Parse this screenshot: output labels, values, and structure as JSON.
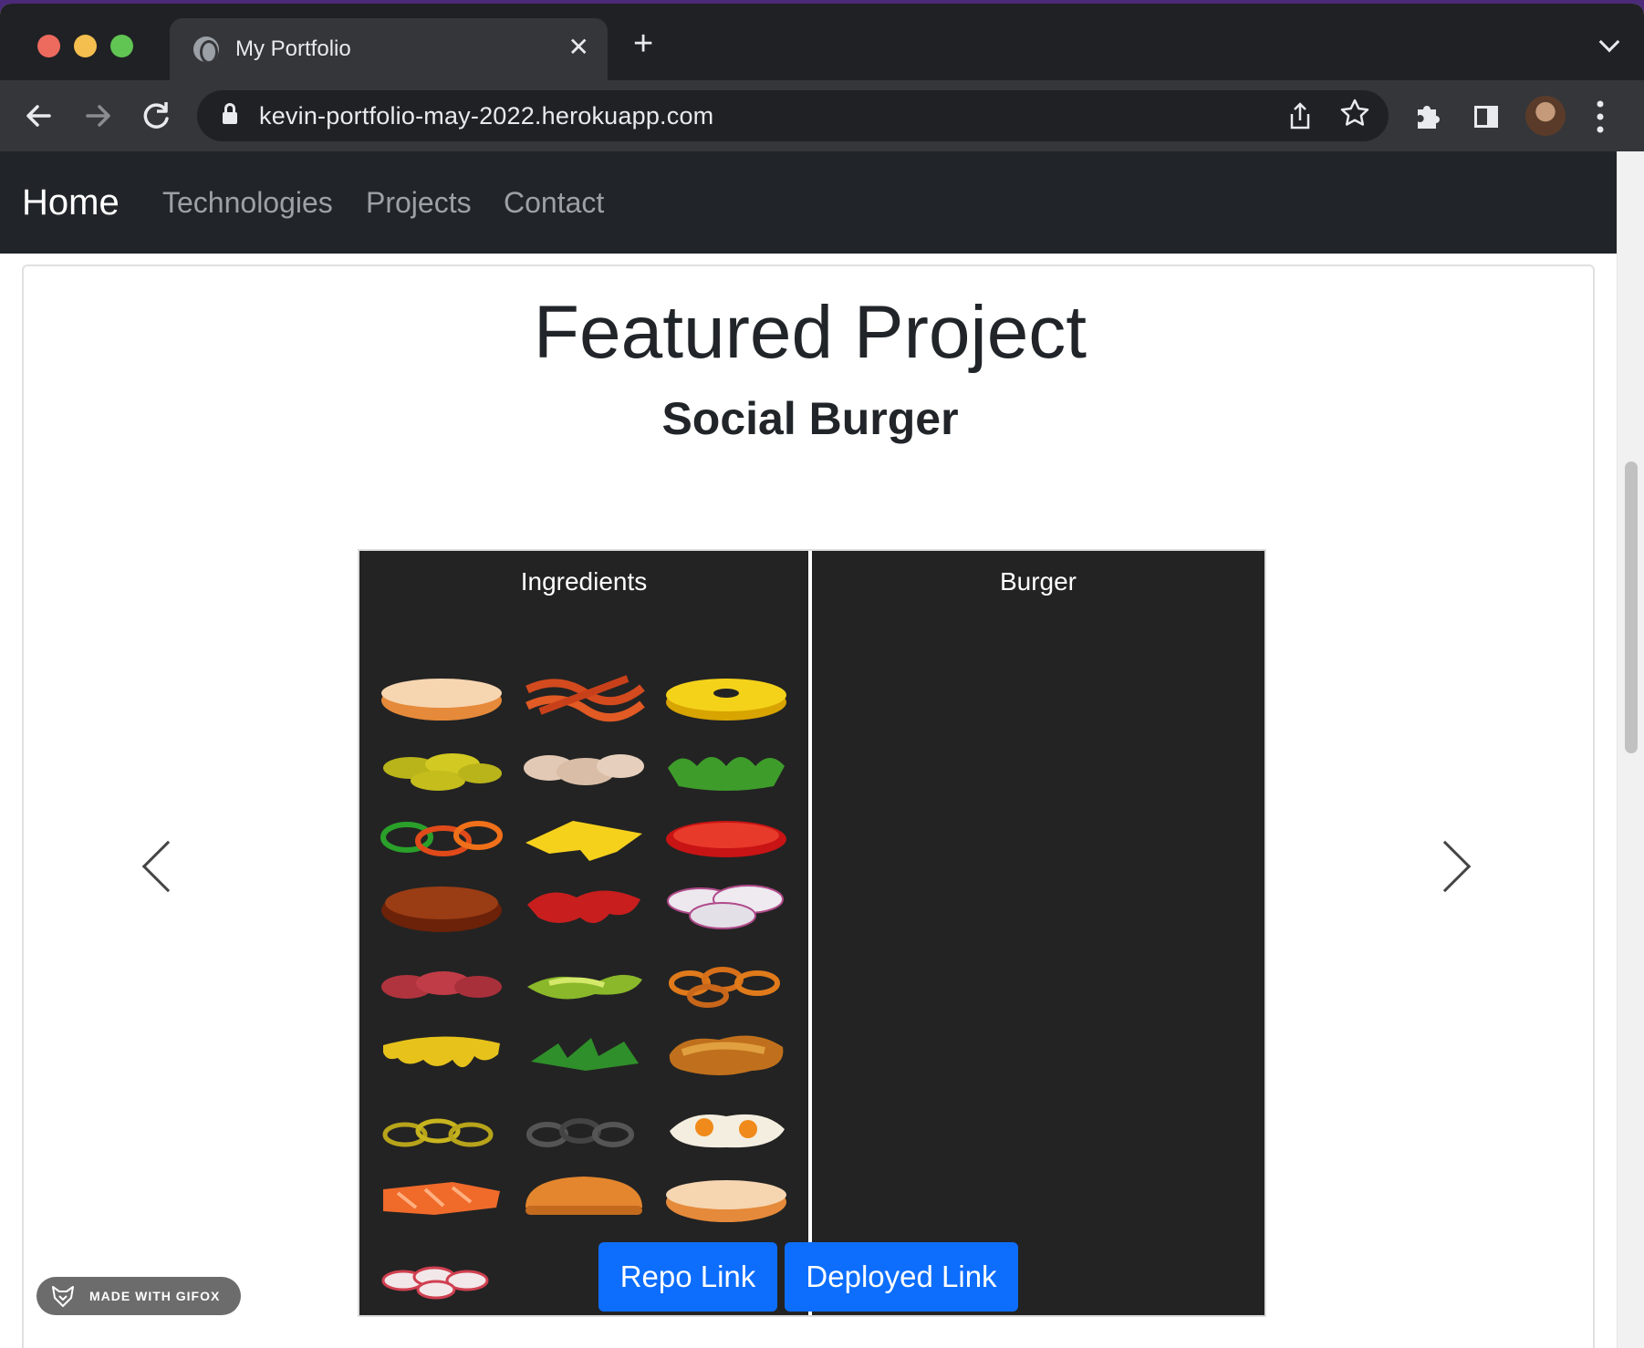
{
  "browser": {
    "tab_title": "My Portfolio",
    "tab_close": "✕",
    "new_tab": "+",
    "url": "kevin-portfolio-may-2022.herokuapp.com"
  },
  "navbar": {
    "brand": "Home",
    "links": [
      "Technologies",
      "Projects",
      "Contact"
    ]
  },
  "featured": {
    "heading": "Featured Project",
    "project_name": "Social Burger"
  },
  "app": {
    "ingredients_title": "Ingredients",
    "burger_title": "Burger",
    "ingredients": [
      "bottom-bun",
      "bacon",
      "pineapple",
      "pickles",
      "mushrooms",
      "lettuce",
      "peppers",
      "cheese",
      "tomato",
      "beef-patty",
      "ketchup",
      "onion",
      "salami",
      "avocado",
      "onion-rings",
      "melted-cheese",
      "arugula",
      "chicken-cutlet",
      "banana-peppers",
      "olives",
      "fried-eggs",
      "salmon",
      "top-bun",
      "bottom-bun-2",
      "radishes"
    ]
  },
  "buttons": {
    "repo": "Repo Link",
    "deployed": "Deployed Link"
  },
  "watermark": {
    "text": "MADE WITH GIFOX"
  },
  "colors": {
    "navbar_bg": "#212529",
    "primary_button": "#0d6efd",
    "panel_bg": "#232323"
  }
}
